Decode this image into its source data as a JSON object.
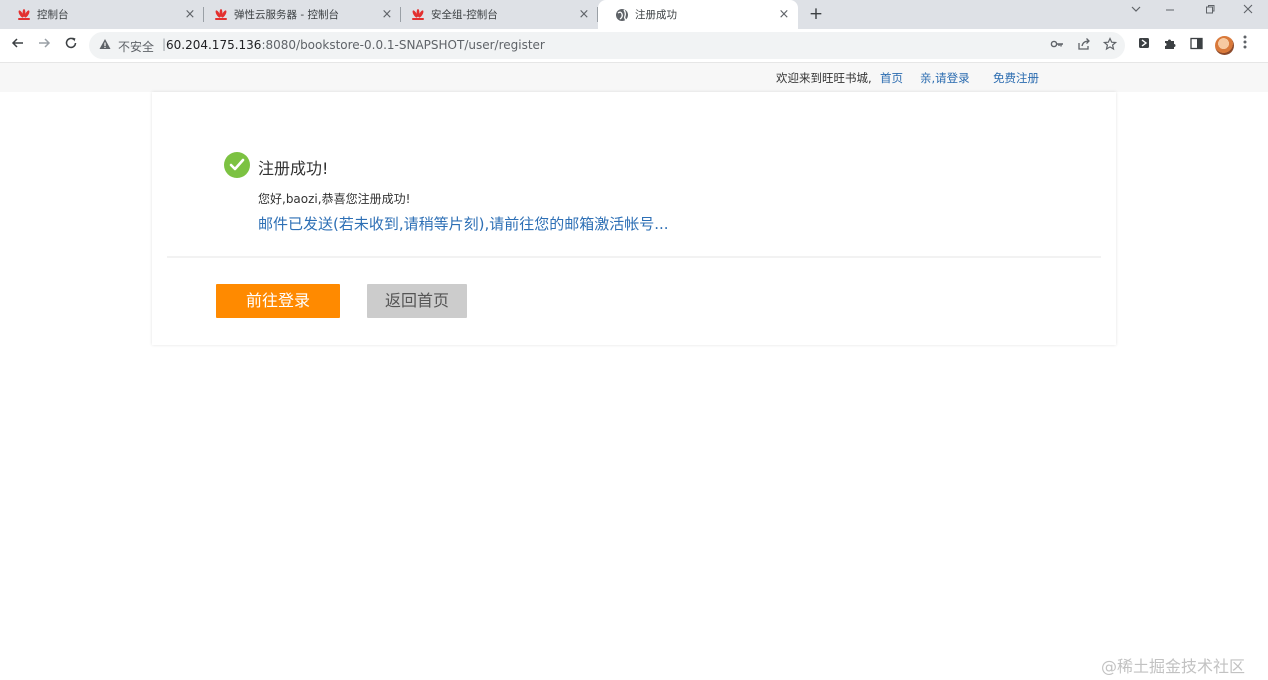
{
  "browser": {
    "tabs": [
      {
        "label": "控制台",
        "active": false
      },
      {
        "label": "弹性云服务器 - 控制台",
        "active": false
      },
      {
        "label": "安全组-控制台",
        "active": false
      },
      {
        "label": "注册成功",
        "active": true
      }
    ],
    "close_glyph": "×",
    "newtab_glyph": "+",
    "address": {
      "security_label": "不安全",
      "host": "60.204.175.136",
      "path": ":8080/bookstore-0.0.1-SNAPSHOT/user/register"
    }
  },
  "header": {
    "welcome": "欢迎来到旺旺书城,",
    "links": {
      "home": "首页",
      "login": "亲,请登录",
      "register": "免费注册"
    }
  },
  "content": {
    "title": "注册成功!",
    "greeting": "您好,baozi,恭喜您注册成功!",
    "mail_note": "邮件已发送(若未收到,请稍等片刻),请前往您的邮箱激活帐号...",
    "login_button": "前往登录",
    "home_button": "返回首页"
  },
  "watermark": "@稀土掘金技术社区",
  "colors": {
    "brand_orange": "#ff8a00",
    "success_green": "#7cc242",
    "link_blue": "#2d6fb5",
    "huawei_red": "#e3302f"
  }
}
